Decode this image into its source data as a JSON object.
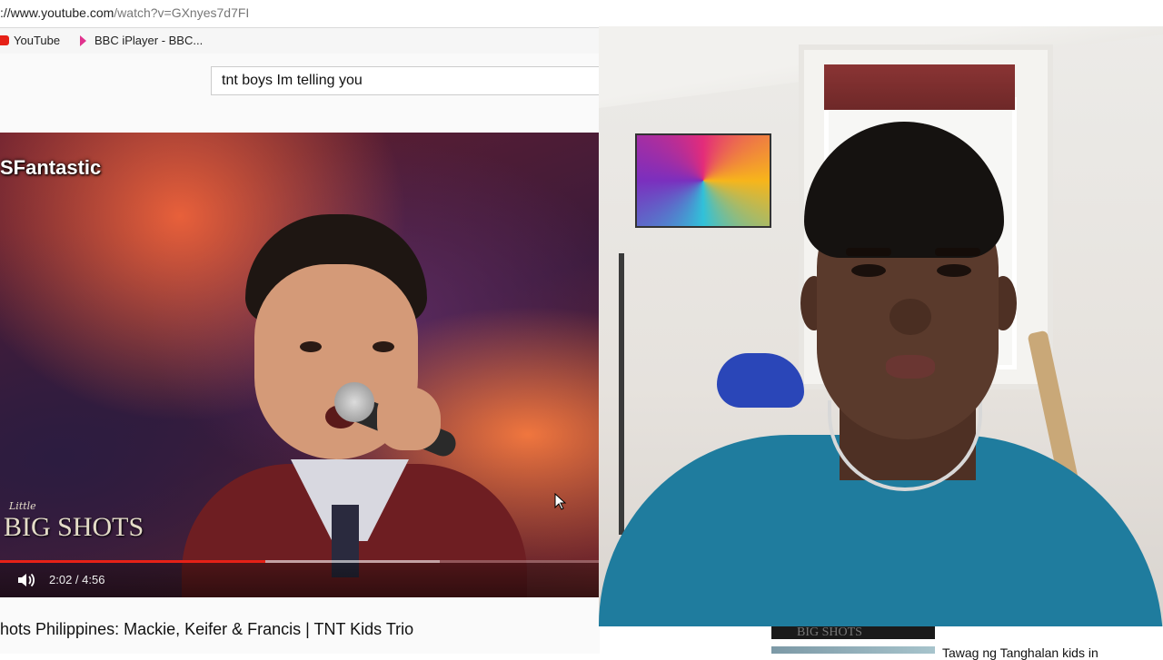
{
  "browser": {
    "url_host": "://www.youtube.com",
    "url_path": "/watch?v=GXnyes7d7FI",
    "bookmarks": [
      {
        "label": "YouTube",
        "icon": "youtube-icon"
      },
      {
        "label": "BBC iPlayer - BBC...",
        "icon": "bbc-iplayer-icon"
      }
    ]
  },
  "youtube": {
    "search_query": "tnt boys Im telling you",
    "video": {
      "watermark": "SFantastic",
      "show_logo_small": "Little",
      "show_logo_big": "BIG SHOTS",
      "progress_played_fraction": 0.443,
      "progress_buffered_fraction": 0.733,
      "current_time": "2:02",
      "duration": "4:56",
      "time_display": "2:02 / 4:56",
      "accent_color": "#e62117"
    },
    "title": "hots Philippines: Mackie, Keifer & Francis | TNT Kids Trio",
    "sidebar": {
      "thumb1_text": "BIG SHOTS",
      "item2_title": "Tawag ng Tanghalan kids in"
    }
  },
  "webcam": {
    "shirt_color": "#1f7c9e"
  }
}
